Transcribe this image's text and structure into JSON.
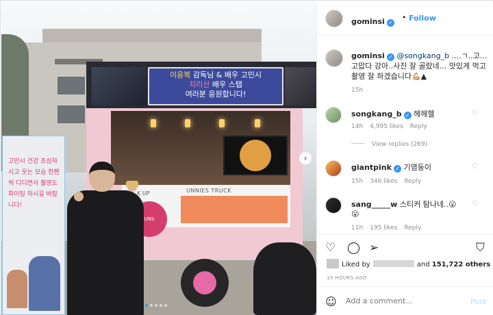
{
  "photo": {
    "banner": {
      "line1_a": "이응복",
      "line1_b": " 감독님 & 배우 ",
      "line1_c": "고민시",
      "line2_a": "지리산",
      "line2_b": " 배우 스탭",
      "line3": "여러분 응원합니다!"
    },
    "truck_name": "UNNIES TRUCK",
    "pickup": "K UP",
    "logo": "UNS",
    "standee_text": "고민시 건강 조심하시고 웃는 모습 한팬씩 디디면서 촬영도 화이팅 하시길 바랍니다!",
    "next_glyph": "›",
    "slide_count": 5,
    "active_slide": 1
  },
  "header": {
    "username": "gominsi",
    "verified_glyph": "✓",
    "separator": "•",
    "follow_label": "Follow"
  },
  "caption": {
    "username": "gominsi",
    "mention": "@songkang_b",
    "text_after": " ....ㄱ..고...고맙다 강아..사진 잘 골랐네... 맛있게 먹고 촬영 잘 하겠습니다💪🏼▲",
    "time": "15h"
  },
  "comments": [
    {
      "username": "songkang_b",
      "text": "헤헤헬",
      "time": "14h",
      "likes": "4,995 likes",
      "reply": "Reply"
    },
    {
      "username": "giantpink",
      "text": "기염둥이",
      "time": "15h",
      "likes": "346 likes",
      "reply": "Reply"
    },
    {
      "username": "sang_____w",
      "text": "스티커 탐나네..😮",
      "extra": "😮",
      "time": "11h",
      "likes": "195 likes",
      "reply": "Reply"
    }
  ],
  "view_replies": "View replies (269)",
  "actions": {
    "like_icon": "heart-icon",
    "comment_icon": "comment-icon",
    "share_icon": "share-icon",
    "save_icon": "bookmark-icon"
  },
  "likes": {
    "prefix": "Liked by",
    "and": "and",
    "count": "151,722 others"
  },
  "time_ago": "15 HOURS AGO",
  "comment_input": {
    "placeholder": "Add a comment...",
    "post_label": "Post"
  },
  "colors": {
    "accent": "#3897f0",
    "post_disabled": "#b2dffc",
    "muted": "#8e8e8e"
  }
}
